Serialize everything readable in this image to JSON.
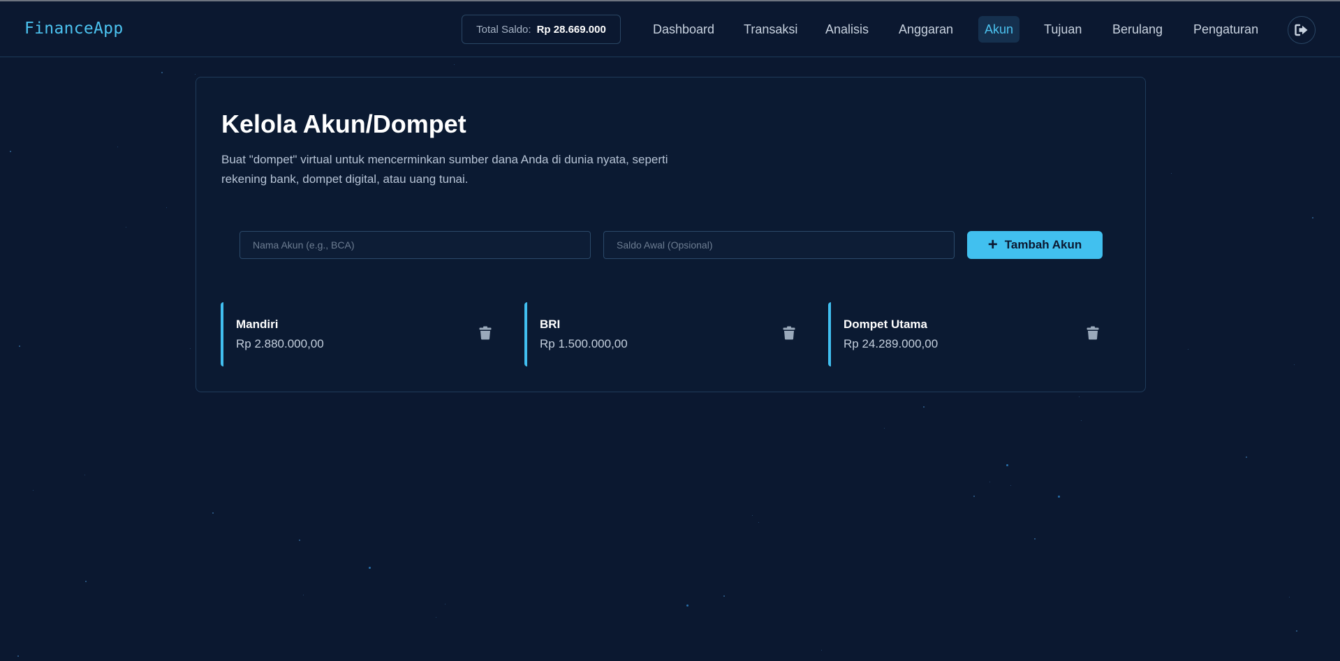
{
  "header": {
    "brand": "FinanceApp",
    "total_balance_label": "Total Saldo:",
    "total_balance_value": "Rp 28.669.000",
    "nav": [
      {
        "label": "Dashboard",
        "active": false
      },
      {
        "label": "Transaksi",
        "active": false
      },
      {
        "label": "Analisis",
        "active": false
      },
      {
        "label": "Anggaran",
        "active": false
      },
      {
        "label": "Akun",
        "active": true
      },
      {
        "label": "Tujuan",
        "active": false
      },
      {
        "label": "Berulang",
        "active": false
      },
      {
        "label": "Pengaturan",
        "active": false
      }
    ],
    "logout_icon": "sign-out-icon"
  },
  "page": {
    "title": "Kelola Akun/Dompet",
    "description": "Buat \"dompet\" virtual untuk mencerminkan sumber dana Anda di dunia nyata, seperti rekening bank, dompet digital, atau uang tunai."
  },
  "form": {
    "name_placeholder": "Nama Akun (e.g., BCA)",
    "name_value": "",
    "balance_placeholder": "Saldo Awal (Opsional)",
    "balance_value": "",
    "add_button_label": "Tambah Akun",
    "add_button_icon": "plus-icon"
  },
  "accounts": [
    {
      "name": "Mandiri",
      "balance": "Rp 2.880.000,00"
    },
    {
      "name": "BRI",
      "balance": "Rp 1.500.000,00"
    },
    {
      "name": "Dompet Utama",
      "balance": "Rp 24.289.000,00"
    }
  ],
  "colors": {
    "background": "#0b1830",
    "accent": "#41c0ef",
    "card_border": "#1f3b5a",
    "text_primary": "#ffffff",
    "text_muted": "#b7c4d6"
  }
}
